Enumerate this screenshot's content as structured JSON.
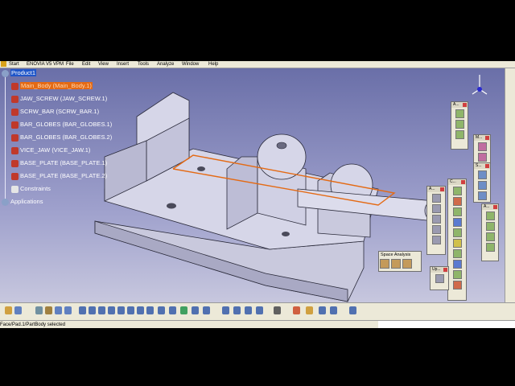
{
  "menu": {
    "items": [
      "Start",
      "ENOVIA V5 VPM",
      "File",
      "Edit",
      "View",
      "Insert",
      "Tools",
      "Analyze",
      "Window",
      "Help"
    ]
  },
  "tree": {
    "root": "Product1",
    "nodes": [
      {
        "label": "Main_Body (Main_Body.1)",
        "selected": true
      },
      {
        "label": "JAW_SCREW (JAW_SCREW.1)",
        "selected": false
      },
      {
        "label": "SCRW_BAR (SCRW_BAR.1)",
        "selected": false
      },
      {
        "label": "BAR_GLOBES (BAR_GLOBES.1)",
        "selected": false
      },
      {
        "label": "BAR_GLOBES (BAR_GLOBES.2)",
        "selected": false
      },
      {
        "label": "VICE_JAW (VICE_JAW.1)",
        "selected": false
      },
      {
        "label": "BASE_PLATE (BASE_PLATE.1)",
        "selected": false
      },
      {
        "label": "BASE_PLATE (BASE_PLATE.2)",
        "selected": false
      }
    ],
    "constraints": "Constraints",
    "applications": "Applications"
  },
  "toolbars": {
    "space_analysis": "Space Analysis",
    "a1": "A...",
    "m": "M...",
    "s": "S...",
    "c": "C...",
    "a2": "A...",
    "a3": "A...",
    "up": "Up..."
  },
  "status_text": "Face/Pad.1/PartBody selected",
  "colors": {
    "selection": "#e46a14",
    "root_highlight": "#1f56c9",
    "background_top": "#6a6fa8",
    "model_face": "#d6d6e8"
  }
}
